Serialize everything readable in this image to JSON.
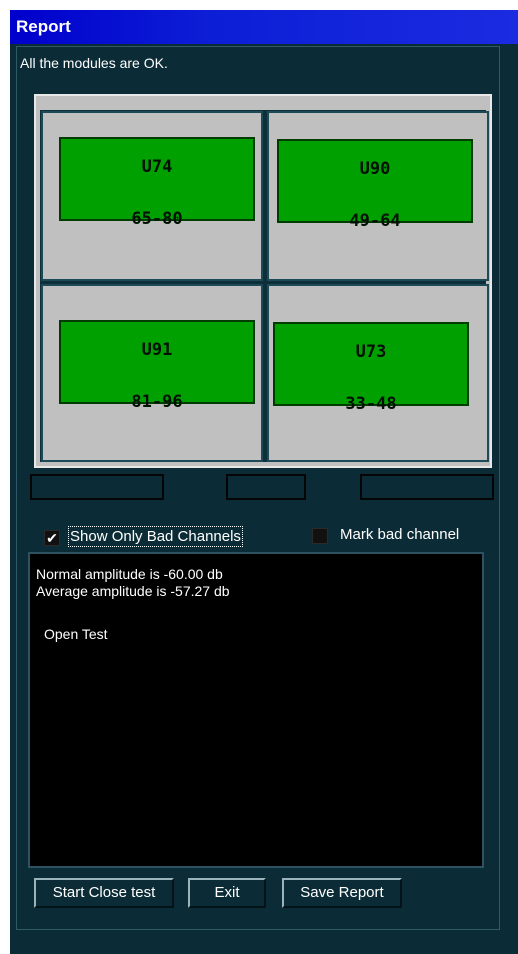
{
  "window": {
    "title": "Report"
  },
  "status_message": "All the modules are OK.",
  "modules": [
    {
      "name": "U74",
      "range": "65-80",
      "color": "#00a000"
    },
    {
      "name": "U90",
      "range": "49-64",
      "color": "#00a000"
    },
    {
      "name": "U91",
      "range": "81-96",
      "color": "#00a000"
    },
    {
      "name": "U73",
      "range": "33-48",
      "color": "#00a000"
    }
  ],
  "options": {
    "show_only_bad": {
      "label": "Show Only Bad Channels",
      "checked": true,
      "mark": "✔"
    },
    "mark_bad": {
      "label": "Mark bad channel",
      "checked": false
    }
  },
  "log": {
    "normal_amplitude": "Normal amplitude is -60.00 db",
    "average_amplitude": "Average amplitude is -57.27 db",
    "test_name": "Open Test"
  },
  "buttons": {
    "start_close": "Start Close test",
    "exit": "Exit",
    "save_report": "Save Report"
  }
}
